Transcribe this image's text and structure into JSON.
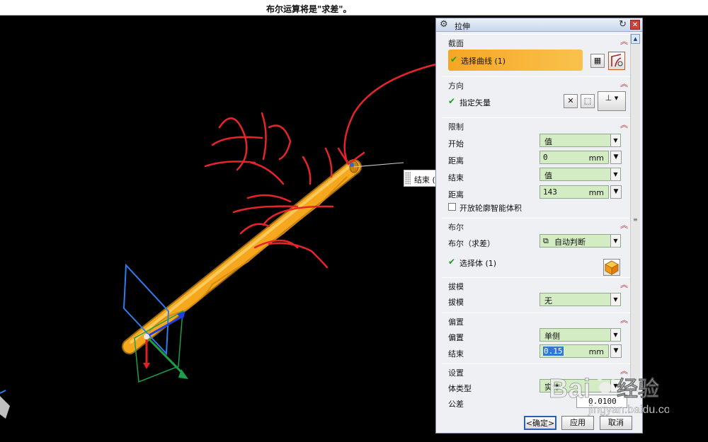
{
  "status_bar": {
    "message": "布尔运算将是\"求差\"。"
  },
  "viewport": {
    "callout_label": "结束 ("
  },
  "dialog": {
    "title": "拉伸",
    "sections": {
      "section_curve": {
        "header": "截面",
        "select_curve": "选择曲线 (1)"
      },
      "direction": {
        "header": "方向",
        "vector_label": "指定矢量"
      },
      "limits": {
        "header": "限制",
        "start_label": "开始",
        "start_value": "值",
        "distance_label": "距离",
        "start_distance": "0",
        "end_label": "结束",
        "end_value": "值",
        "distance2_label": "距离",
        "end_distance": "143",
        "unit": "mm",
        "open_profile": "开放轮廓智能体积"
      },
      "boolean": {
        "header": "布尔",
        "boolean_label": "布尔（求差）",
        "boolean_value": "自动判断",
        "select_body": "选择体 (1)"
      },
      "draft": {
        "header": "拔模",
        "draft_label": "拔模",
        "draft_value": "无"
      },
      "offset": {
        "header": "偏置",
        "offset_label": "偏置",
        "offset_value": "单侧",
        "end_label": "结束",
        "end_value": "0.15",
        "unit": "mm"
      },
      "settings": {
        "header": "设置",
        "body_type_label": "体类型",
        "body_type_value": "实体",
        "tolerance_label": "公差",
        "tolerance_value": "0.0100"
      }
    },
    "buttons": {
      "ok": "<确定>",
      "apply": "应用",
      "cancel": "取消"
    }
  },
  "watermark": {
    "brand": "Bai",
    "suffix": "经验",
    "url": "jingyan.baidu.com"
  },
  "colors": {
    "cylinder": "#f5a81e",
    "highlight": "#f6a623",
    "field": "#d3ecc4",
    "annotation": "#e8242a"
  }
}
